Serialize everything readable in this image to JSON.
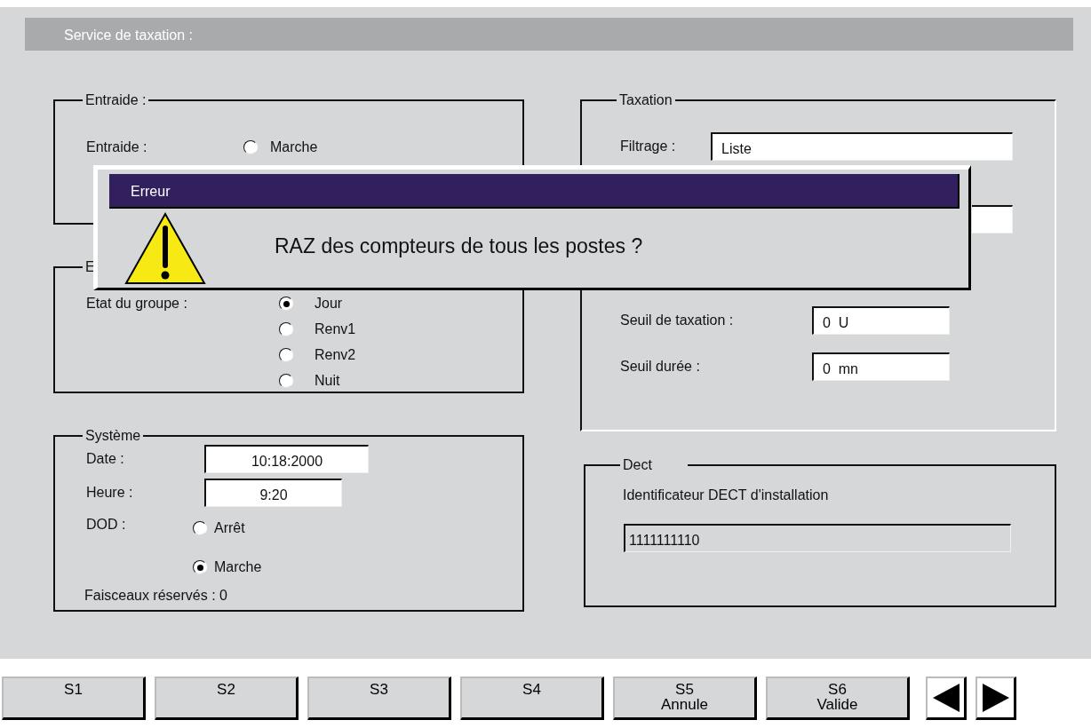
{
  "header": {
    "title": "Service de taxation :"
  },
  "entraide": {
    "legend": "Entraide :",
    "label": "Entraide :",
    "options": [
      {
        "label": "Marche",
        "selected": false
      }
    ]
  },
  "groupe": {
    "legend": "E",
    "label": "Etat du groupe :",
    "options": [
      {
        "label": "Jour",
        "selected": true
      },
      {
        "label": "Renv1",
        "selected": false
      },
      {
        "label": "Renv2",
        "selected": false
      },
      {
        "label": "Nuit",
        "selected": false
      }
    ]
  },
  "systeme": {
    "legend": "Système",
    "fields": [
      {
        "label": "Date :",
        "value": "10:18:2000"
      },
      {
        "label": "Heure :",
        "value": "9:20"
      }
    ],
    "dod": {
      "label": "DOD :",
      "options": [
        {
          "label": "Arrêt",
          "selected": false
        },
        {
          "label": "Marche",
          "selected": true
        }
      ]
    },
    "footer": "Faisceaux réservés : 0"
  },
  "taxation": {
    "legend": "Taxation",
    "filter": {
      "label": "Filtrage :",
      "value": "Liste"
    },
    "thresholds": [
      {
        "label": "Seuil de taxation :",
        "value": "0  U"
      },
      {
        "label": "Seuil durée :",
        "value": "0  mn"
      }
    ]
  },
  "dect": {
    "legend": "Dect",
    "label": "Identificateur DECT d'installation",
    "value": "1111111110"
  },
  "dialog": {
    "title": "Erreur",
    "message": "RAZ des compteurs de tous les postes ?"
  },
  "softkeys": [
    {
      "lines": [
        "S1"
      ]
    },
    {
      "lines": [
        "S2"
      ]
    },
    {
      "lines": [
        "S3"
      ]
    },
    {
      "lines": [
        "S4"
      ]
    },
    {
      "lines": [
        "S5",
        "Annule"
      ]
    },
    {
      "lines": [
        "S6",
        "Valide"
      ]
    }
  ],
  "nav": [
    {
      "kind": "prev"
    },
    {
      "kind": "next"
    }
  ]
}
